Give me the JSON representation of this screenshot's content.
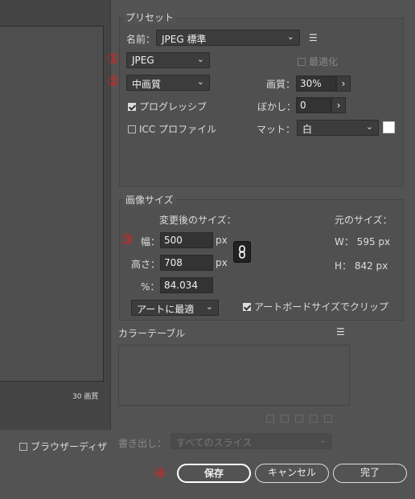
{
  "preset": {
    "section_title": "プリセット",
    "name_label": "名前：",
    "name_value": "JPEG 標準",
    "format_value": "JPEG",
    "optimize_label": "最適化",
    "quality_preset_value": "中画質",
    "quality_label": "画質：",
    "quality_value": "30%",
    "progressive_label": "プログレッシブ",
    "progressive_checked": true,
    "blur_label": "ぼかし：",
    "blur_value": "0",
    "icc_label": "ICC プロファイル",
    "icc_checked": false,
    "matte_label": "マット：",
    "matte_value": "白",
    "matte_color": "#ffffff"
  },
  "image_size": {
    "section_title": "画像サイズ",
    "new_size_label": "変更後のサイズ：",
    "original_size_label": "元のサイズ：",
    "width_label": "幅：",
    "width_value": "500",
    "height_label": "高さ：",
    "height_value": "708",
    "unit": "px",
    "percent_label": "%：",
    "percent_value": "84.034",
    "orig_w": "W： 595 px",
    "orig_h": "H： 842 px",
    "fit_value": "アートに最適",
    "clip_label": "アートボードサイズでクリップ",
    "clip_checked": true
  },
  "color_table": {
    "section_title": "カラーテーブル"
  },
  "export": {
    "label": "書き出し：",
    "value": "すべてのスライス"
  },
  "preview": {
    "zoom_text": "30 画質",
    "browser_dither_label": "ブラウザーディザ"
  },
  "buttons": {
    "save": "保存",
    "cancel": "キャンセル",
    "done": "完了"
  },
  "annotations": {
    "n1": "①",
    "n2": "②",
    "n3": "③",
    "n4": "④",
    "color": "#e02020"
  },
  "icons": [
    "menu-icon",
    "chevron-down-icon",
    "chevron-right-icon",
    "link-icon",
    "trash-icon",
    "lock-icon",
    "add-icon",
    "cube-icon",
    "grid-icon"
  ]
}
